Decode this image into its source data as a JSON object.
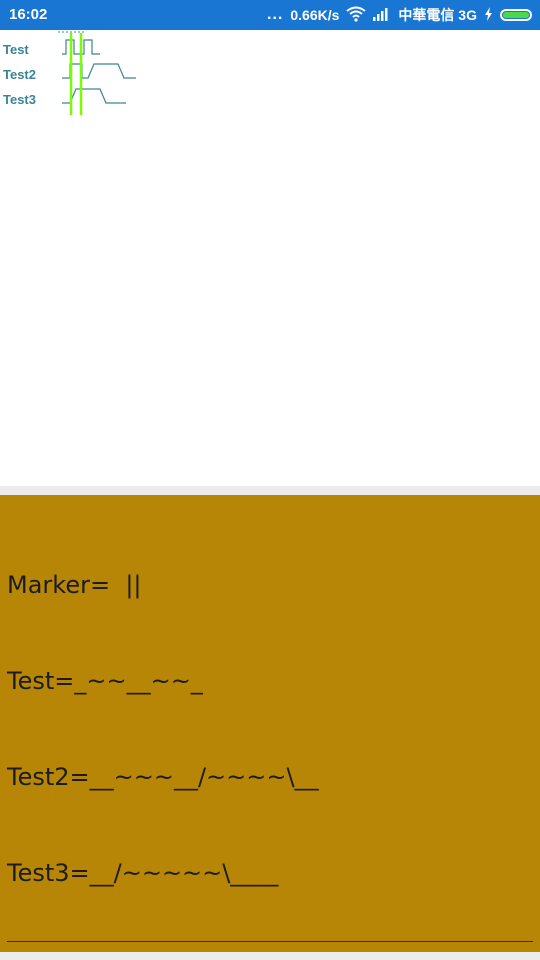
{
  "status_bar": {
    "time": "16:02",
    "dots": "...",
    "speed": "0.66K/s",
    "carrier": "中華電信 3G",
    "icons": [
      "wifi-icon",
      "signal-icon",
      "charging-icon",
      "battery-icon"
    ],
    "color": "#1976d2"
  },
  "waveform": {
    "signals": [
      {
        "name": "Test"
      },
      {
        "name": "Test2"
      },
      {
        "name": "Test3"
      }
    ],
    "trace_color": "#3b8497",
    "marker_color": "#7cfc00"
  },
  "panel": {
    "background": "#b78606",
    "lines": [
      "Marker=  ||",
      "Test=_~~__~~_",
      "Test2=__~~~__/~~~~\\__",
      "Test3=__/~~~~~\\____"
    ]
  }
}
